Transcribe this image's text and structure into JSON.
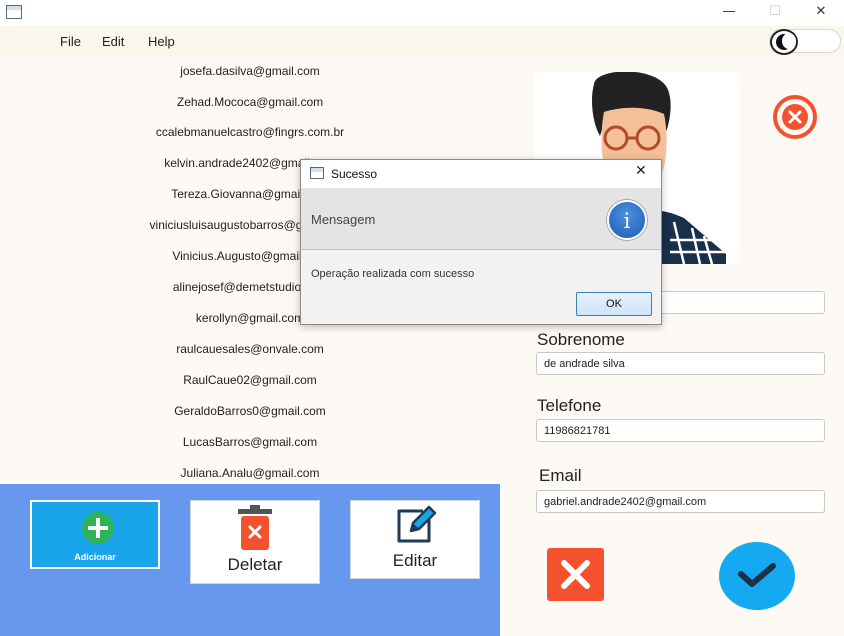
{
  "window": {
    "min_glyph": "—",
    "max_glyph": "☐",
    "close_glyph": "✕"
  },
  "menu": [
    "File",
    "Edit",
    "Help"
  ],
  "emails": [
    "josefa.dasilva@gmail.com",
    "Zehad.Mococa@gmail.com",
    "ccalebmanuelcastro@fingrs.com.br",
    "kelvin.andrade2402@gmail.com",
    "Tereza.Giovanna@gmail.com",
    "viniciusluisaugustobarros@gmail.com",
    "Vinicius.Augusto@gmail.com",
    "alinejosef@demetstudio.com",
    "kerollyn@gmail.com",
    "raulcauesales@onvale.com",
    "RaulCaue02@gmail.com",
    "GeraldoBarros0@gmail.com",
    "LucasBarros@gmail.com",
    "Juliana.Analu@gmail.com"
  ],
  "actions": {
    "add": "Adicionar",
    "delete": "Deletar",
    "edit": "Editar"
  },
  "form": {
    "nome_value": "",
    "sobrenome_label": "Sobrenome",
    "sobrenome_value": "de andrade silva",
    "telefone_label": "Telefone",
    "telefone_value": "11986821781",
    "email_label": "Email",
    "email_value": "gabriel.andrade2402@gmail.com"
  },
  "dialog": {
    "title": "Sucesso",
    "header": "Mensagem",
    "info_glyph": "i",
    "message": "Operação realizada com sucesso",
    "ok_label": "OK",
    "close_glyph": "✕"
  },
  "colors": {
    "action_panel": "#6699ee",
    "add_button": "#1aa5ea",
    "cancel_button": "#f4522e",
    "confirm_button": "#14a9f1"
  }
}
